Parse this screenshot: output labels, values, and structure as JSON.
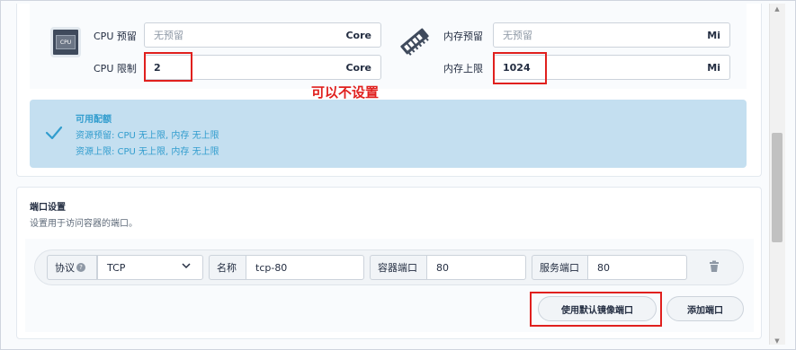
{
  "resources": {
    "cpu_icon_text": "CPU",
    "cpu_reservation": {
      "label": "CPU 预留",
      "placeholder": "无预留",
      "value": "",
      "unit": "Core"
    },
    "cpu_limit": {
      "label": "CPU 限制",
      "value": "2",
      "unit": "Core"
    },
    "mem_reservation": {
      "label": "内存预留",
      "placeholder": "无预留",
      "value": "",
      "unit": "Mi"
    },
    "mem_limit": {
      "label": "内存上限",
      "value": "1024",
      "unit": "Mi"
    }
  },
  "annotation": "可以不设置",
  "quota": {
    "title": "可用配额",
    "reservation": "资源预留:  CPU 无上限, 内存 无上限",
    "limit": "资源上限:  CPU 无上限, 内存 无上限"
  },
  "ports": {
    "title": "端口设置",
    "description": "设置用于访问容器的端口。",
    "row": {
      "protocol_label": "协议",
      "protocol_value": "TCP",
      "name_label": "名称",
      "name_value": "tcp-80",
      "container_port_label": "容器端口",
      "container_port_value": "80",
      "service_port_label": "服务端口",
      "service_port_value": "80"
    },
    "use_default_button": "使用默认镜像端口",
    "add_button": "添加端口"
  },
  "colors": {
    "annotation_red": "#e0201e",
    "quota_bg": "#c4dff0",
    "quota_text": "#329dce"
  }
}
